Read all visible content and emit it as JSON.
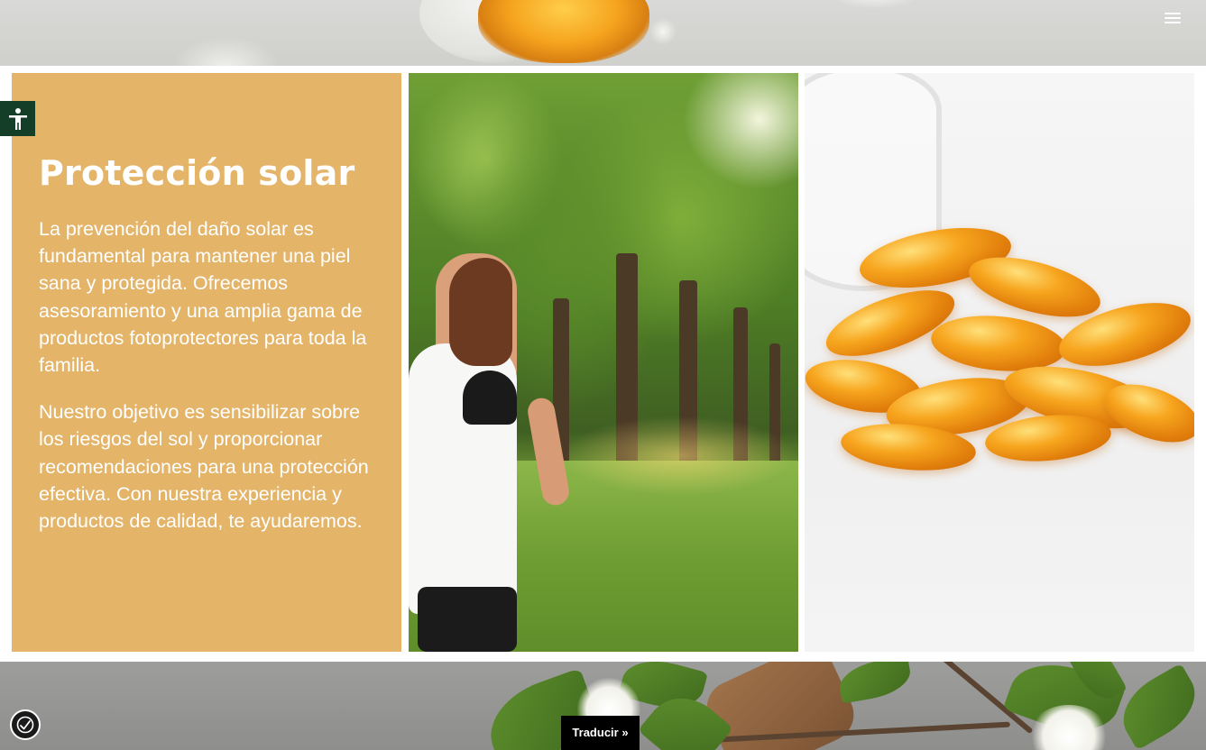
{
  "header": {
    "menu_icon": "hamburger-icon"
  },
  "section": {
    "title": "Protección solar",
    "paragraph1": "La prevención del daño solar es fundamental para mantener una piel sana y protegida. Ofrecemos asesoramiento y una amplia gama de productos fotoprotectores para toda la familia.",
    "paragraph2": "Nuestro objetivo es sensibilizar sobre los riesgos del sol y proporcionar recomendaciones para una protección efectiva. Con nuestra experiencia y productos de calidad, te ayudaremos.",
    "panel_color": "#e4b469",
    "text_color": "#ffffff"
  },
  "widgets": {
    "accessibility_tab_icon": "accessibility-person-icon",
    "accessibility_tab_color": "#153e28",
    "accessibility_button_icon": "accessibility-hand-icon",
    "translate_label": "Traducir »"
  }
}
